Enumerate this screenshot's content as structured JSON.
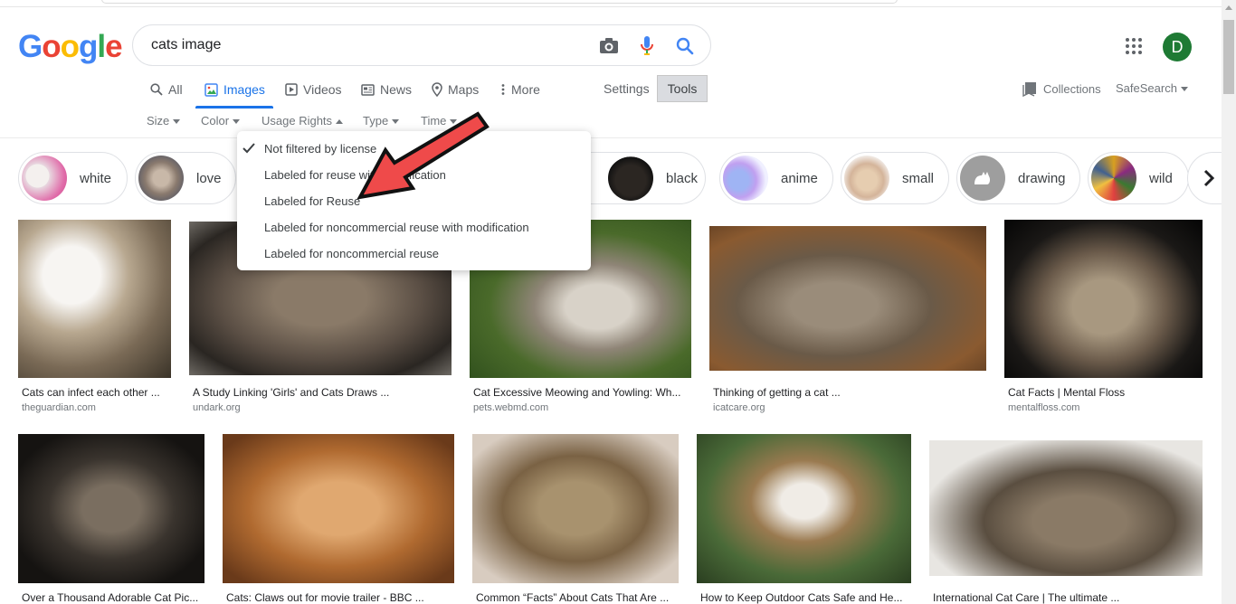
{
  "search": {
    "query": "cats image"
  },
  "logo": {
    "letters": [
      "G",
      "o",
      "o",
      "g",
      "l",
      "e"
    ],
    "colors": [
      "#4285f4",
      "#ea4335",
      "#fbbc05",
      "#4285f4",
      "#34a853",
      "#ea4335"
    ]
  },
  "tabs": [
    {
      "label": "All",
      "icon": "search-icon"
    },
    {
      "label": "Images",
      "icon": "image-icon"
    },
    {
      "label": "Videos",
      "icon": "play-icon"
    },
    {
      "label": "News",
      "icon": "newspaper-icon"
    },
    {
      "label": "Maps",
      "icon": "map-pin-icon"
    },
    {
      "label": "More",
      "icon": "dots-vertical-icon"
    }
  ],
  "settings_label": "Settings",
  "tools_label": "Tools",
  "collections_label": "Collections",
  "safesearch_label": "SafeSearch",
  "avatar_letter": "D",
  "filters": [
    "Size",
    "Color",
    "Usage Rights",
    "Type",
    "Time"
  ],
  "chips": [
    "white",
    "love",
    "black",
    "anime",
    "small",
    "drawing",
    "wild"
  ],
  "dropdown": {
    "items": [
      "Not filtered by license",
      "Labeled for reuse with modification",
      "Labeled for Reuse",
      "Labeled for noncommercial reuse with modification",
      "Labeled for noncommercial reuse"
    ],
    "checked_index": 0
  },
  "results": [
    {
      "title": "Cats can infect each other ...",
      "source": "theguardian.com"
    },
    {
      "title": "A Study Linking 'Girls' and Cats Draws ...",
      "source": "undark.org"
    },
    {
      "title": "Cat Excessive Meowing and Yowling: Wh...",
      "source": "pets.webmd.com"
    },
    {
      "title": "Thinking of getting a cat ...",
      "source": "icatcare.org"
    },
    {
      "title": "Cat Facts | Mental Floss",
      "source": "mentalfloss.com"
    },
    {
      "title": "Over a Thousand Adorable Cat Pic...",
      "source": ""
    },
    {
      "title": "Cats: Claws out for movie trailer - BBC ...",
      "source": ""
    },
    {
      "title": "Common “Facts” About Cats That Are ...",
      "source": ""
    },
    {
      "title": "How to Keep Outdoor Cats Safe and He...",
      "source": ""
    },
    {
      "title": "International Cat Care | The ultimate ...",
      "source": ""
    }
  ],
  "colors": {
    "accent": "#1a73e8",
    "arrow": "#ef4a4a",
    "avatar": "#1e7a34"
  }
}
